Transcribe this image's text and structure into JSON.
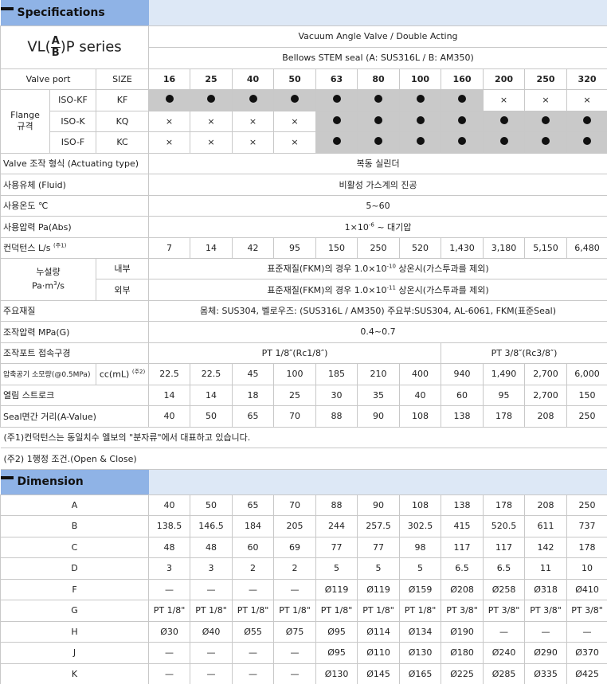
{
  "spec": {
    "section_title": "Specifications",
    "series_label": {
      "prefix": "VL(",
      "num": "A",
      "den": "B",
      "suffix": ")P series"
    },
    "title_line1": "Vacuum Angle Valve / Double Acting",
    "title_line2": "Bellows STEM seal (A: SUS316L / B: AM350)",
    "valve_port_label": "Valve port",
    "size_label": "SIZE",
    "sizes": [
      "16",
      "25",
      "40",
      "50",
      "63",
      "80",
      "100",
      "160",
      "200",
      "250",
      "320"
    ],
    "flange_label": "Flange\n규격",
    "flange_rows": [
      {
        "name": "ISO-KF",
        "code": "KF",
        "marks": [
          "dot",
          "dot",
          "dot",
          "dot",
          "dot",
          "dot",
          "dot",
          "dot",
          "×",
          "×",
          "×"
        ]
      },
      {
        "name": "ISO-K",
        "code": "KQ",
        "marks": [
          "×",
          "×",
          "×",
          "×",
          "dot",
          "dot",
          "dot",
          "dot",
          "dot",
          "dot",
          "dot"
        ]
      },
      {
        "name": "ISO-F",
        "code": "KC",
        "marks": [
          "×",
          "×",
          "×",
          "×",
          "dot",
          "dot",
          "dot",
          "dot",
          "dot",
          "dot",
          "dot"
        ]
      }
    ],
    "actuating_label": "Valve 조작 형식 (Actuating type)",
    "actuating_value": "복동 실린더",
    "fluid_label": "사용유체 (Fluid)",
    "fluid_value": "비활성 가스계의 진공",
    "temp_label": "사용온도 ℃",
    "temp_value": "5~60",
    "pressure_label": "사용압력 Pa(Abs)",
    "pressure_value_pre": "1×10",
    "pressure_value_sup": "-6",
    "pressure_value_post": " ~ 대기압",
    "conductance_label": "컨덕턴스 L/s",
    "conductance_note": "(주1)",
    "conductance_values": [
      "7",
      "14",
      "42",
      "95",
      "150",
      "250",
      "520",
      "1,430",
      "3,180",
      "5,150",
      "6,480"
    ],
    "leak_label_1": "누설량",
    "leak_label_2": "Pa·m",
    "leak_label_sup": "3",
    "leak_label_3": "/s",
    "leak_inner_label": "내부",
    "leak_inner_pre": "표준재질(FKM)의 경우 1.0×10",
    "leak_inner_sup": "-10",
    "leak_inner_post": " 상온시(가스투과를 제외)",
    "leak_outer_label": "외부",
    "leak_outer_pre": "표준재질(FKM)의 경우 1.0×10",
    "leak_outer_sup": "-11",
    "leak_outer_post": " 상온시(가스투과를 제외)",
    "material_label": "주요재질",
    "material_value": "몸체: SUS304, 벨로우즈: (SUS316L / AM350) 주요부:SUS304, AL-6061, FKM(표준Seal)",
    "op_pressure_label": "조작압력  MPa(G)",
    "op_pressure_value": "0.4~0.7",
    "port_label": "조작포트 접속구경",
    "port_value_1": "PT 1/8″(Rc1/8″)",
    "port_value_2": "PT 3/8″(Rc3/8″)",
    "air_label": "압축공기 소모량(@0.5MPa)",
    "air_unit": "cc(mL)",
    "air_note": "(주2)",
    "air_values": [
      "22.5",
      "22.5",
      "45",
      "100",
      "185",
      "210",
      "400",
      "940",
      "1,490",
      "2,700",
      "6,000"
    ],
    "stroke_label": "열림 스트로크",
    "stroke_values": [
      "14",
      "14",
      "18",
      "25",
      "30",
      "35",
      "40",
      "60",
      "95",
      "2,700",
      "150"
    ],
    "seal_label": "Seal면간 거리(A-Value)",
    "seal_values": [
      "40",
      "50",
      "65",
      "70",
      "88",
      "90",
      "108",
      "138",
      "178",
      "208",
      "250"
    ],
    "note1": "(주1)컨덕턴스는 동일치수 엘보의 \"분자류\"에서 대표하고 있습니다.",
    "note2": "(주2) 1행정 조건.(Open & Close)"
  },
  "dimension": {
    "section_title": "Dimension",
    "rows": [
      {
        "label": "A",
        "values": [
          "40",
          "50",
          "65",
          "70",
          "88",
          "90",
          "108",
          "138",
          "178",
          "208",
          "250"
        ]
      },
      {
        "label": "B",
        "values": [
          "138.5",
          "146.5",
          "184",
          "205",
          "244",
          "257.5",
          "302.5",
          "415",
          "520.5",
          "611",
          "737"
        ]
      },
      {
        "label": "C",
        "values": [
          "48",
          "48",
          "60",
          "69",
          "77",
          "77",
          "98",
          "117",
          "117",
          "142",
          "178"
        ]
      },
      {
        "label": "D",
        "values": [
          "3",
          "3",
          "2",
          "2",
          "5",
          "5",
          "5",
          "6.5",
          "6.5",
          "11",
          "10"
        ]
      },
      {
        "label": "F",
        "values": [
          "—",
          "—",
          "—",
          "—",
          "Ø119",
          "Ø119",
          "Ø159",
          "Ø208",
          "Ø258",
          "Ø318",
          "Ø410"
        ]
      },
      {
        "label": "G",
        "values": [
          "PT 1/8\"",
          "PT 1/8\"",
          "PT 1/8\"",
          "PT 1/8\"",
          "PT 1/8\"",
          "PT 1/8\"",
          "PT 1/8\"",
          "PT 3/8\"",
          "PT 3/8\"",
          "PT 3/8\"",
          "PT 3/8\""
        ]
      },
      {
        "label": "H",
        "values": [
          "Ø30",
          "Ø40",
          "Ø55",
          "Ø75",
          "Ø95",
          "Ø114",
          "Ø134",
          "Ø190",
          "—",
          "—",
          "—"
        ]
      },
      {
        "label": "J",
        "values": [
          "—",
          "—",
          "—",
          "—",
          "Ø95",
          "Ø110",
          "Ø130",
          "Ø180",
          "Ø240",
          "Ø290",
          "Ø370"
        ]
      },
      {
        "label": "K",
        "values": [
          "—",
          "—",
          "—",
          "—",
          "Ø130",
          "Ø145",
          "Ø165",
          "Ø225",
          "Ø285",
          "Ø335",
          "Ø425"
        ]
      }
    ]
  }
}
